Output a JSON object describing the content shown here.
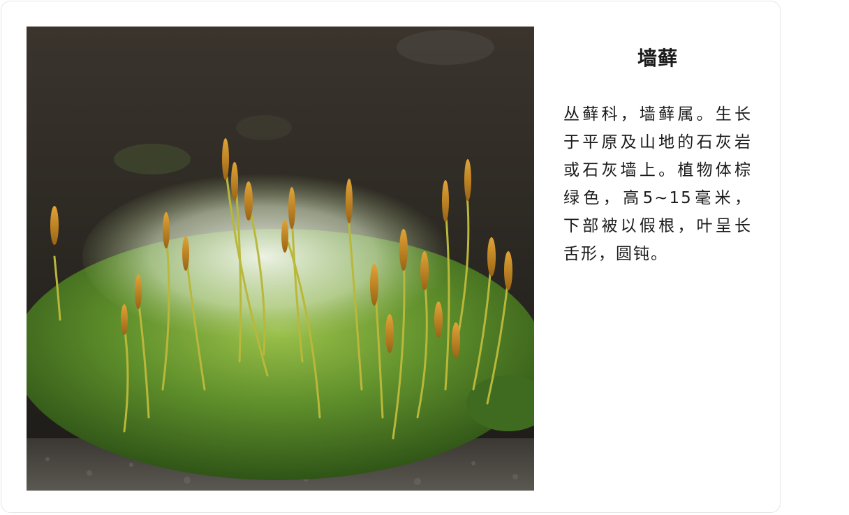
{
  "card": {
    "image_subject": "moss",
    "title": "墙藓",
    "description": "丛藓科，墙藓属。生长于平原及山地的石灰岩或石灰墙上。植物体棕绿色，高5~15毫米，下部被以假根，叶呈长舌形，圆钝。"
  },
  "colors": {
    "background": "#ffffff",
    "card_border": "#e6e6e6",
    "text": "#1a1a1a",
    "moss_green": "#5a8a2a",
    "capsule_orange": "#c98a1e"
  }
}
